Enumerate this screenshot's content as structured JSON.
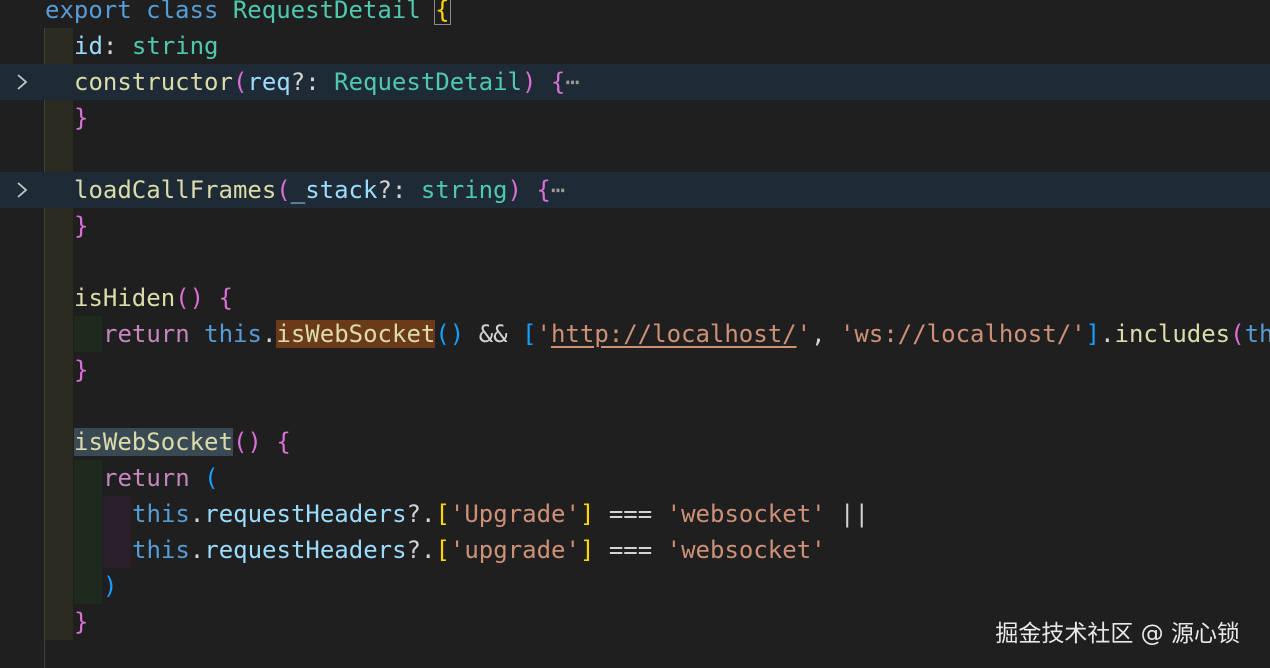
{
  "editor": {
    "lines": {
      "l1": {
        "t1": "export",
        "t2": " ",
        "t3": "class",
        "t4": " ",
        "t5": "RequestDetail",
        "t6": " ",
        "t7": "{"
      },
      "l2": {
        "t1": "id",
        "t2": ": ",
        "t3": "string"
      },
      "l3": {
        "t1": "constructor",
        "t2": "(",
        "t3": "req",
        "t4": "?: ",
        "t5": "RequestDetail",
        "t6": ")",
        "t7": " ",
        "t8": "{",
        "t9": "⋯"
      },
      "l4": {
        "t1": "}"
      },
      "l6": {
        "t1": "loadCallFrames",
        "t2": "(",
        "t3": "_stack",
        "t4": "?: ",
        "t5": "string",
        "t6": ")",
        "t7": " ",
        "t8": "{",
        "t9": "⋯"
      },
      "l7": {
        "t1": "}"
      },
      "l9": {
        "t1": "isHiden",
        "t2": "()",
        "t3": " ",
        "t4": "{"
      },
      "l10": {
        "t1": "return",
        "t2": " ",
        "t3": "this",
        "t4": ".",
        "t5": "isWebSocket",
        "t6": "()",
        "t7": " && ",
        "t8": "[",
        "t9": "'",
        "t10": "http://localhost/",
        "t11": "'",
        "t12": ", ",
        "t13": "'ws://localhost/'",
        "t14": "]",
        "t15": ".",
        "t16": "includes",
        "t17": "(",
        "t18": "th"
      },
      "l11": {
        "t1": "}"
      },
      "l13": {
        "t1": "isWebSocket",
        "t2": "()",
        "t3": " ",
        "t4": "{"
      },
      "l14": {
        "t1": "return",
        "t2": " ",
        "t3": "("
      },
      "l15": {
        "t1": "this",
        "t2": ".",
        "t3": "requestHeaders",
        "t4": "?.",
        "t5": "[",
        "t6": "'Upgrade'",
        "t7": "]",
        "t8": " === ",
        "t9": "'websocket'",
        "t10": " ||"
      },
      "l16": {
        "t1": "this",
        "t2": ".",
        "t3": "requestHeaders",
        "t4": "?.",
        "t5": "[",
        "t6": "'upgrade'",
        "t7": "]",
        "t8": " === ",
        "t9": "'websocket'"
      },
      "l17": {
        "t1": ")"
      },
      "l18": {
        "t1": "}"
      }
    }
  },
  "watermark": "掘金技术社区 @ 源心锁",
  "icons": {
    "fold": "chevron-right-icon"
  },
  "colors": {
    "background": "#1f1f1f",
    "folded_line": "#1e2a35",
    "keyword": "#569cd6",
    "control": "#c586c0",
    "function": "#dcdcaa",
    "type": "#4ec9b0",
    "property": "#9cdcfe",
    "string": "#ce9178",
    "bracket_1": "#ffd700",
    "bracket_2": "#da70d6",
    "bracket_3": "#179fff"
  }
}
